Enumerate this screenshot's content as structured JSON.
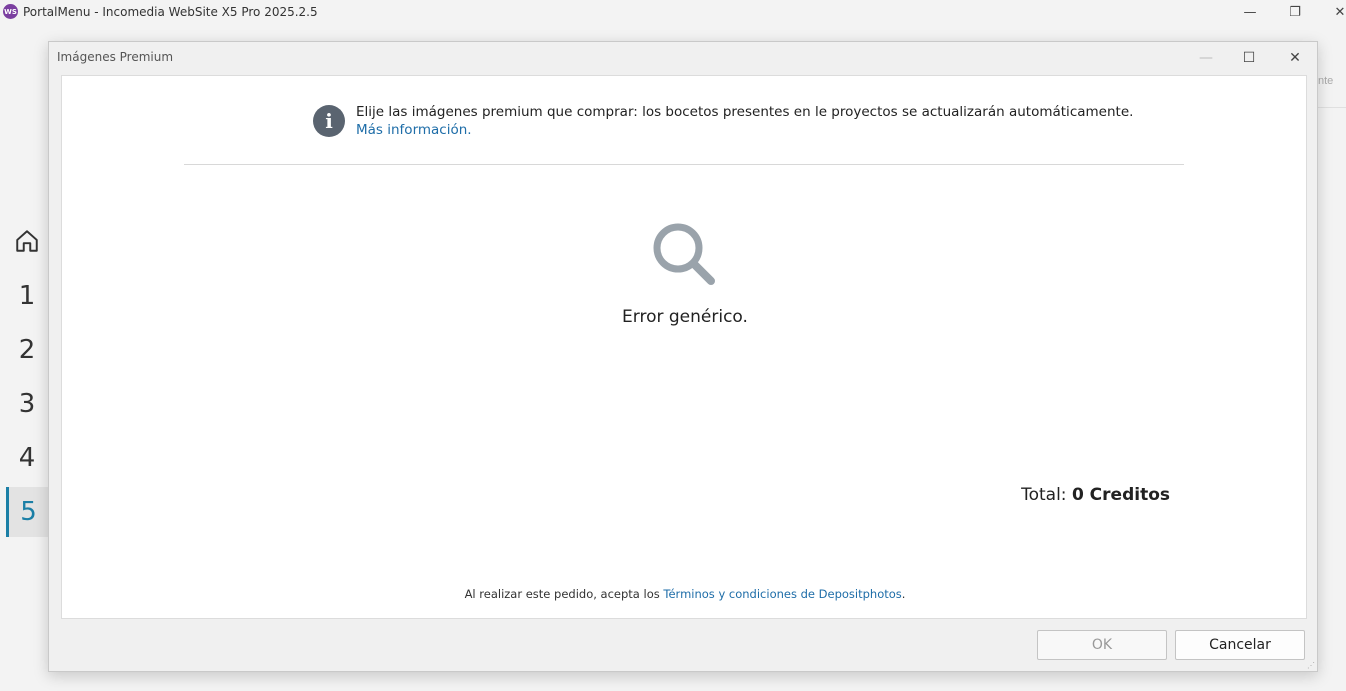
{
  "app": {
    "logo": "WS",
    "title": "PortalMenu - Incomedia WebSite X5 Pro 2025.2.5",
    "minimize": "—",
    "maximize": "❐",
    "close": "✕",
    "bg_panel_text": "nte"
  },
  "sidebar": {
    "home_icon": "home-icon",
    "steps": [
      "1",
      "2",
      "3",
      "4",
      "5"
    ],
    "active_step": "5",
    "accent_color": "#1b7fa6"
  },
  "dialog": {
    "title": "Imágenes Premium",
    "minimize": "—",
    "maximize": "☐",
    "close": "✕",
    "info_icon": "i",
    "info_text": "Elije las imágenes premium que comprar: los bocetos presentes en le proyectos se actualizarán automáticamente.",
    "info_link": "Más información.",
    "error_text": "Error genérico.",
    "total_label": "Total:",
    "total_value": "0 Creditos",
    "terms_prefix": "Al realizar este pedido, acepta los ",
    "terms_link": "Términos y condiciones de Depositphotos",
    "terms_suffix": ".",
    "ok_label": "OK",
    "cancel_label": "Cancelar",
    "link_color": "#1e6da8"
  }
}
